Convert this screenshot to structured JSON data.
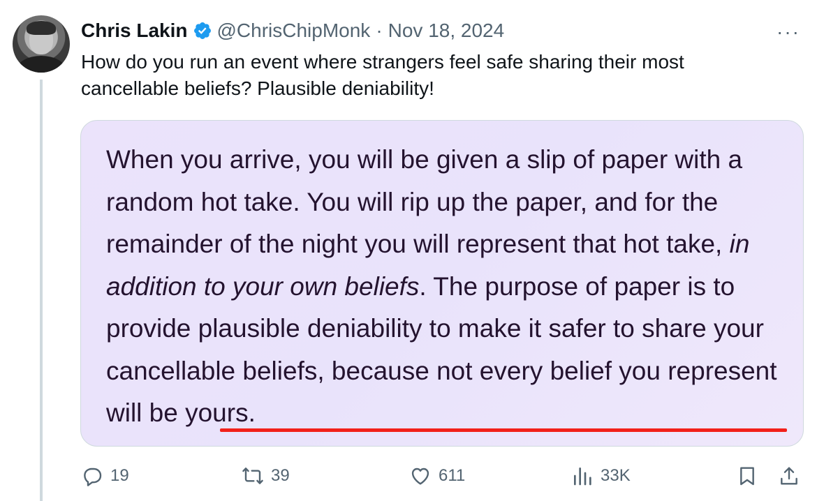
{
  "tweet": {
    "author_name": "Chris Lakin",
    "handle": "@ChrisChipMonk",
    "separator": "·",
    "date": "Nov 18, 2024",
    "more": "···",
    "text": "How do you run an event where strangers feel safe sharing their most cancellable beliefs? Plausible deniability!"
  },
  "quote_card": {
    "part1": "When you arrive, you will be given a slip of paper with a random hot take. You will rip up the paper, and for the remainder of the night you will represent that hot take, ",
    "italic": "in addition to your own beliefs",
    "part2": ". The purpose of paper is to provide plausible deniability to make it safer to share your cancellable beliefs, because ",
    "underlined": "not every belief you represent will be yours."
  },
  "actions": {
    "replies": "19",
    "reposts": "39",
    "likes": "611",
    "views": "33K"
  },
  "colors": {
    "card_bg": "#ebe3fb",
    "quote_text": "#24132f",
    "underline": "#f2201a",
    "verified": "#1d9bf0"
  }
}
